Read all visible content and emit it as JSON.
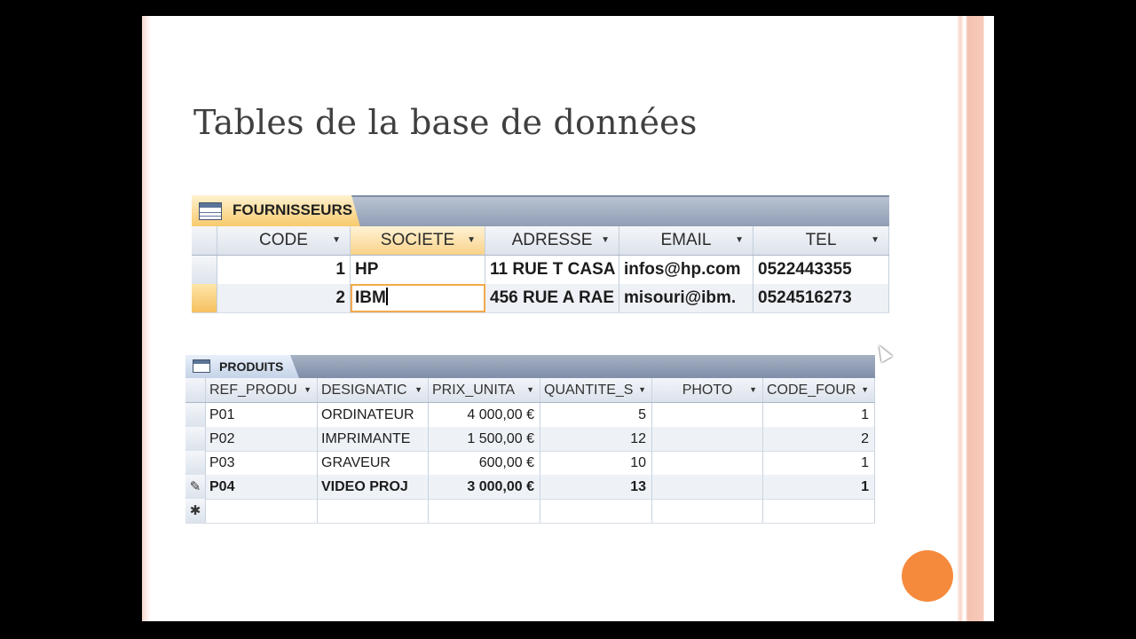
{
  "slide": {
    "title": "Tables de la base de données"
  },
  "fournisseurs": {
    "tab_label": "FOURNISSEURS",
    "columns": [
      "CODE",
      "SOCIETE",
      "ADRESSE",
      "EMAIL",
      "TEL"
    ],
    "rows": [
      {
        "code": "1",
        "societe": "HP",
        "adresse": "11 RUE T CASA",
        "email": "infos@hp.com",
        "tel": "0522443355"
      },
      {
        "code": "2",
        "societe": "IBM",
        "adresse": "456  RUE A RAE",
        "email": "misouri@ibm.",
        "tel": "0524516273"
      }
    ]
  },
  "produits": {
    "tab_label": "PRODUITS",
    "columns": [
      "REF_PRODU",
      "DESIGNATIC",
      "PRIX_UNITA",
      "QUANTITE_S",
      "PHOTO",
      "CODE_FOUR"
    ],
    "rows": [
      {
        "ref": "P01",
        "designation": "ORDINATEUR",
        "prix": "4 000,00 €",
        "quantite": "5",
        "photo": "",
        "code_four": "1"
      },
      {
        "ref": "P02",
        "designation": "IMPRIMANTE",
        "prix": "1 500,00 €",
        "quantite": "12",
        "photo": "",
        "code_four": "2"
      },
      {
        "ref": "P03",
        "designation": "GRAVEUR",
        "prix": "600,00 €",
        "quantite": "10",
        "photo": "",
        "code_four": "1"
      },
      {
        "ref": "P04",
        "designation": "VIDEO PROJ",
        "prix": "3 000,00 €",
        "quantite": "13",
        "photo": "",
        "code_four": "1"
      }
    ],
    "edit_marker": "✎",
    "new_row_marker": "✱"
  },
  "colors": {
    "accent": "#f58a3c",
    "selected_header": "#f9d38a",
    "tab_bar": "#8e9cb3"
  }
}
